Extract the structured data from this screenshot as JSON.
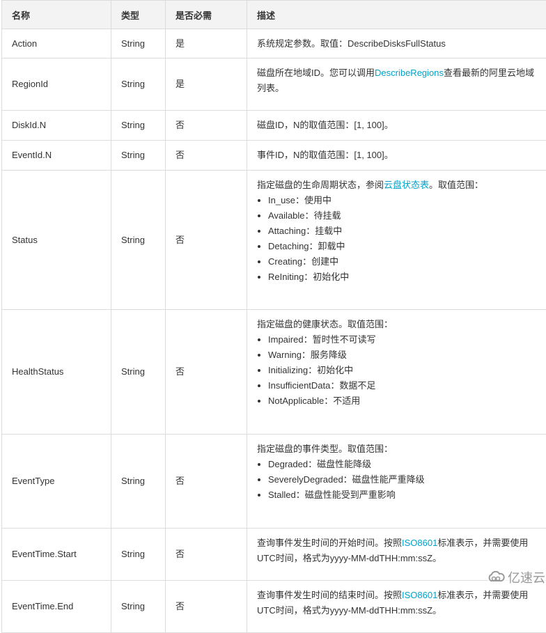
{
  "table": {
    "headers": [
      "名称",
      "类型",
      "是否必需",
      "描述"
    ],
    "rows": [
      {
        "name": "Action",
        "type": "String",
        "required": "是",
        "desc": {
          "text": "系统规定参数。取值：DescribeDisksFullStatus"
        }
      },
      {
        "name": "RegionId",
        "type": "String",
        "required": "是",
        "desc": {
          "before": "磁盘所在地域ID。您可以调用",
          "link": "DescribeRegions",
          "after": "查看最新的阿里云地域列表。"
        }
      },
      {
        "name": "DiskId.N",
        "type": "String",
        "required": "否",
        "desc": {
          "text": "磁盘ID，N的取值范围：[1, 100]。"
        }
      },
      {
        "name": "EventId.N",
        "type": "String",
        "required": "否",
        "desc": {
          "text": "事件ID，N的取值范围：[1, 100]。"
        }
      },
      {
        "name": "Status",
        "type": "String",
        "required": "否",
        "desc": {
          "before": "指定磁盘的生命周期状态，参阅",
          "link": "云盘状态表",
          "after": "。取值范围：",
          "items": [
            "In_use：使用中",
            "Available：待挂载",
            "Attaching：挂载中",
            "Detaching：卸载中",
            "Creating：创建中",
            "ReIniting：初始化中"
          ]
        }
      },
      {
        "name": "HealthStatus",
        "type": "String",
        "required": "否",
        "desc": {
          "text": "指定磁盘的健康状态。取值范围：",
          "items": [
            "Impaired：暂时性不可读写",
            "Warning：服务降级",
            "Initializing：初始化中",
            "InsufficientData：数据不足",
            "NotApplicable：不适用"
          ]
        }
      },
      {
        "name": "EventType",
        "type": "String",
        "required": "否",
        "desc": {
          "text": "指定磁盘的事件类型。取值范围：",
          "items": [
            "Degraded：磁盘性能降级",
            "SeverelyDegraded：磁盘性能严重降级",
            "Stalled：磁盘性能受到严重影响"
          ]
        }
      },
      {
        "name": "EventTime.Start",
        "type": "String",
        "required": "否",
        "desc": {
          "before": "查询事件发生时间的开始时间。按照",
          "link": "ISO8601",
          "after": "标准表示，并需要使用UTC时间，格式为yyyy-MM-ddTHH:mm:ssZ。"
        }
      },
      {
        "name": "EventTime.End",
        "type": "String",
        "required": "否",
        "desc": {
          "before": "查询事件发生时间的结束时间。按照",
          "link": "ISO8601",
          "after": "标准表示，并需要使用UTC时间，格式为yyyy-MM-ddTHH:mm:ssZ。"
        }
      }
    ]
  },
  "watermark": {
    "icon": "cloud-logo-icon",
    "text": "亿速云"
  },
  "colors": {
    "link": "#00a2ca",
    "header_bg": "#f3f3f3",
    "border": "#dcdcdc",
    "text": "#333333"
  }
}
